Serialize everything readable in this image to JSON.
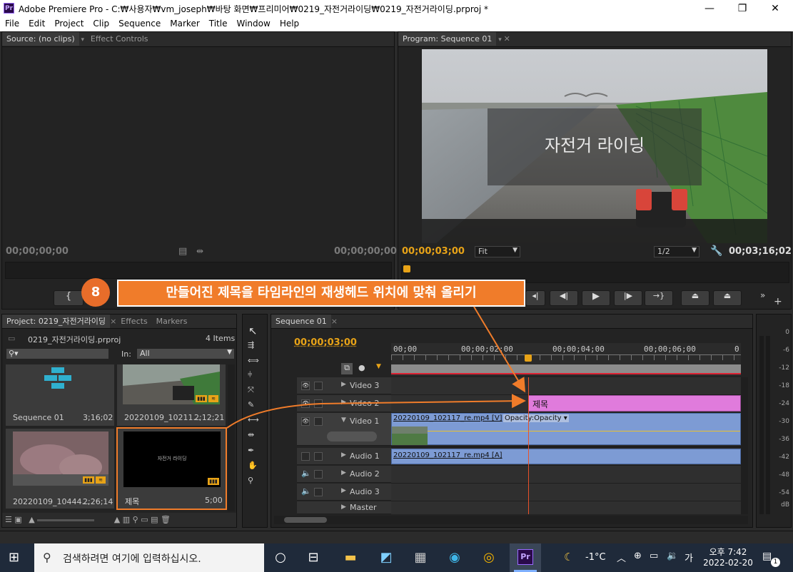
{
  "window": {
    "app_icon": "Pr",
    "title": "Adobe Premiere Pro - C:₩사용자₩vm_joseph₩바탕 화면₩프리미어₩0219_자전거라이딩₩0219_자전거라이딩.prproj *",
    "minimize": "—",
    "maximize": "❐",
    "close": "✕"
  },
  "menu": [
    "File",
    "Edit",
    "Project",
    "Clip",
    "Sequence",
    "Marker",
    "Title",
    "Window",
    "Help"
  ],
  "source_panel": {
    "tab_source": "Source: (no clips)",
    "tab_effect_controls": "Effect Controls",
    "timecode_in": "00;00;00;00",
    "timecode_out": "00;00;00;00"
  },
  "program_panel": {
    "tab": "Program: Sequence 01",
    "title_overlay": "자전거 라이딩",
    "timecode": "00;00;03;00",
    "fit": "Fit",
    "resolution": "1/2",
    "duration": "00;03;16;02"
  },
  "callout": {
    "number": "8",
    "text": "만들어진 제목을 타임라인의 재생헤드 위치에 맞춰 올리기"
  },
  "project_panel": {
    "tab_project": "Project: 0219_자전거라이딩",
    "tab_effects": "Effects",
    "tab_markers": "Markers",
    "file": "0219_자전거라이딩.prproj",
    "items_count": "4 Items",
    "in_label": "In:",
    "in_value": "All",
    "items": [
      {
        "name": "Sequence 01",
        "duration": "3;16;02"
      },
      {
        "name": "20220109_10211...",
        "duration": "2;12;21"
      },
      {
        "name": "20220109_10444...",
        "duration": "2;26;14"
      },
      {
        "name": "제목",
        "duration": "5;00",
        "thumb_text": "자전거 라이딩"
      }
    ]
  },
  "timeline": {
    "tab": "Sequence 01",
    "timecode": "00;00;03;00",
    "ruler": [
      "00;00",
      "00;00;02;00",
      "00;00;04;00",
      "00;00;06;00",
      "0"
    ],
    "tracks": {
      "video3": "Video 3",
      "video2": "Video 2",
      "video1": "Video 1",
      "audio1": "Audio 1",
      "audio2": "Audio 2",
      "audio3": "Audio 3",
      "master": "Master"
    },
    "clip_title": "제목",
    "clip_video": "20220109_102117_re.mp4 [V]",
    "clip_opacity": "Opacity:Opacity ▾",
    "clip_audio": "20220109_102117_re.mp4 [A]"
  },
  "audio_meter": {
    "labels": [
      "0",
      "-6",
      "-12",
      "-18",
      "-24",
      "-30",
      "-36",
      "-42",
      "-48",
      "-54",
      "dB"
    ]
  },
  "taskbar": {
    "search_placeholder": "검색하려면 여기에 입력하십시오.",
    "weather": "-1°C",
    "ime": "가",
    "time": "오후 7:42",
    "date": "2022-02-20",
    "notifications": "1"
  },
  "colors": {
    "timecode": "#e8a317",
    "title_clip": "#e07bdc",
    "video_clip": "#7d9bd4",
    "callout_bg": "#f07c2a",
    "playhead": "#e8512a"
  }
}
